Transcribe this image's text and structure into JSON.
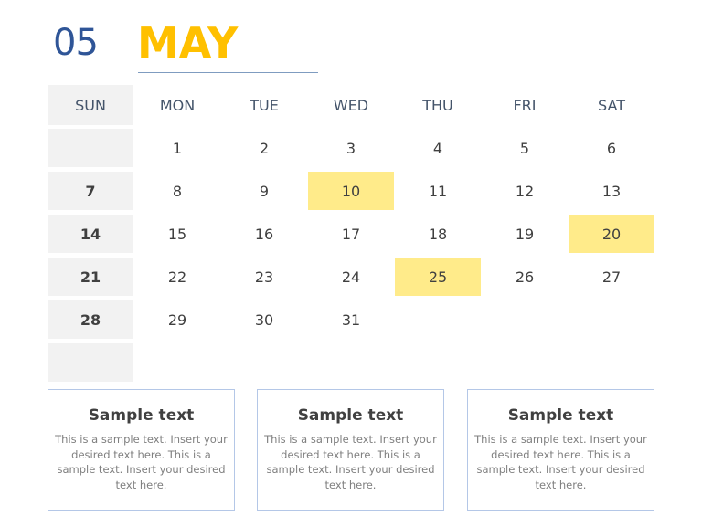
{
  "header": {
    "month_number": "05",
    "month_name": "MAY"
  },
  "calendar": {
    "weekdays": [
      "SUN",
      "MON",
      "TUE",
      "WED",
      "THU",
      "FRI",
      "SAT"
    ],
    "weeks": [
      [
        "",
        "1",
        "2",
        "3",
        "4",
        "5",
        "6"
      ],
      [
        "7",
        "8",
        "9",
        "10",
        "11",
        "12",
        "13"
      ],
      [
        "14",
        "15",
        "16",
        "17",
        "18",
        "19",
        "20"
      ],
      [
        "21",
        "22",
        "23",
        "24",
        "25",
        "26",
        "27"
      ],
      [
        "28",
        "29",
        "30",
        "31",
        "",
        "",
        ""
      ],
      [
        "",
        "",
        "",
        "",
        "",
        "",
        ""
      ]
    ],
    "highlighted_dates": [
      "10",
      "20",
      "25"
    ],
    "highlight_color": "#ffeb8a",
    "sunday_bg": "#f2f2f2"
  },
  "cards": [
    {
      "title": "Sample text",
      "body": "This is a sample text. Insert your desired text here. This is a sample text. Insert your desired text here."
    },
    {
      "title": "Sample text",
      "body": "This is a sample text. Insert your desired text here. This is a sample text. Insert your desired text here."
    },
    {
      "title": "Sample text",
      "body": "This is a sample text. Insert your desired text here. This is a sample text. Insert your desired text here."
    }
  ],
  "colors": {
    "accent": "#ffc000",
    "month_number": "#2f5597",
    "card_border": "#b4c7e7"
  }
}
